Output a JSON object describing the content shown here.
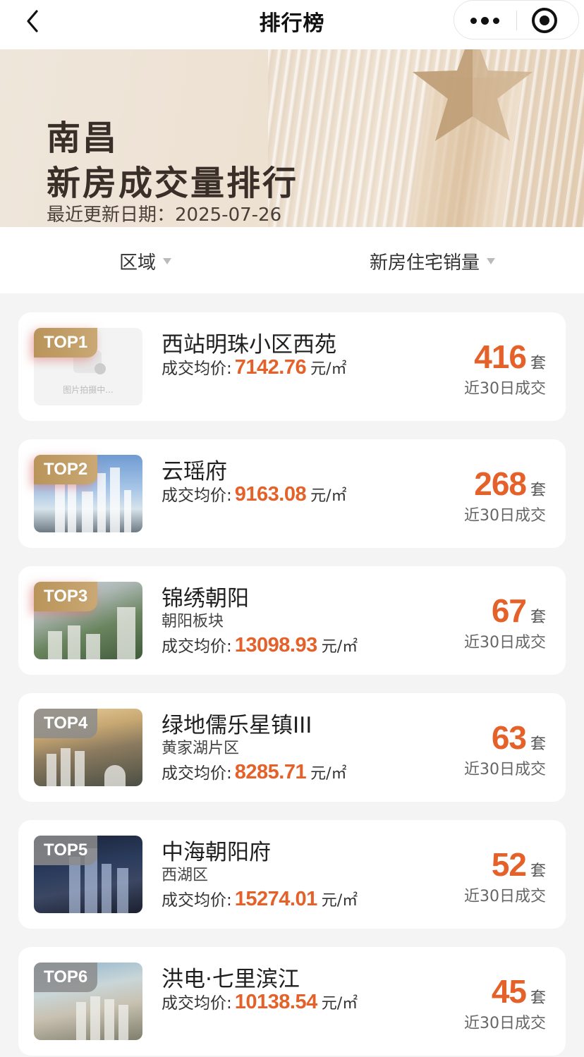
{
  "nav": {
    "title": "排行榜"
  },
  "banner": {
    "city": "南昌",
    "title": "新房成交量排行",
    "date_label": "最近更新日期：",
    "date": "2025-07-26"
  },
  "filters": {
    "region": "区域",
    "sort": "新房住宅销量"
  },
  "list": {
    "price_label": "成交均价:",
    "unit_price": "元/㎡",
    "count_unit": "套",
    "period": "近30日成交",
    "placeholder_text": "图片拍摄中...",
    "items": [
      {
        "rank": "TOP1",
        "name": "西站明珠小区西苑",
        "area": "",
        "price": "7142.76",
        "count": "416"
      },
      {
        "rank": "TOP2",
        "name": "云瑶府",
        "area": "",
        "price": "9163.08",
        "count": "268"
      },
      {
        "rank": "TOP3",
        "name": "锦绣朝阳",
        "area": "朝阳板块",
        "price": "13098.93",
        "count": "67"
      },
      {
        "rank": "TOP4",
        "name": "绿地儒乐星镇III",
        "area": "黄家湖片区",
        "price": "8285.71",
        "count": "63"
      },
      {
        "rank": "TOP5",
        "name": "中海朝阳府",
        "area": "西湖区",
        "price": "15274.01",
        "count": "52"
      },
      {
        "rank": "TOP6",
        "name": "洪电·七里滨江",
        "area": "",
        "price": "10138.54",
        "count": "45"
      }
    ]
  },
  "colors": {
    "accent": "#e5612a",
    "gold_badge": "#b9945a",
    "gray_badge": "#8c8c8c"
  }
}
